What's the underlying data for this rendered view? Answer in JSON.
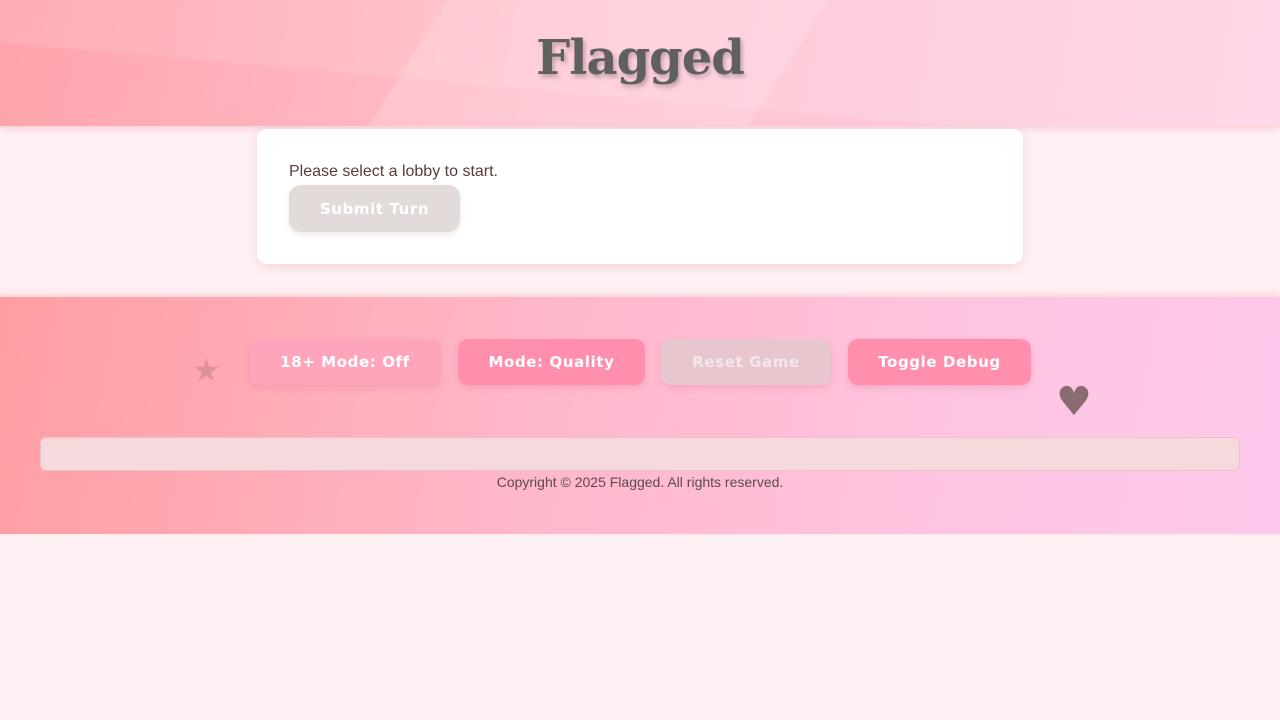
{
  "header": {
    "title": "Flagged"
  },
  "main": {
    "status_text": "Please select a lobby to start.",
    "submit_label": "Submit Turn"
  },
  "footer": {
    "buttons": {
      "adult_mode": "18+ Mode: Off",
      "mode": "Mode: Quality",
      "reset": "Reset Game",
      "debug": "Toggle Debug"
    },
    "decorations": {
      "star": "★",
      "heart": "♥"
    },
    "debug_panel_text": "",
    "copyright": "Copyright © 2025 Flagged. All rights reserved."
  },
  "colors": {
    "accent_pink": "#ff8fac",
    "soft_pink": "#ffa5bb",
    "disabled": "#e3dada",
    "title_gray": "#5f5f5f",
    "background": "#fff0f3"
  }
}
